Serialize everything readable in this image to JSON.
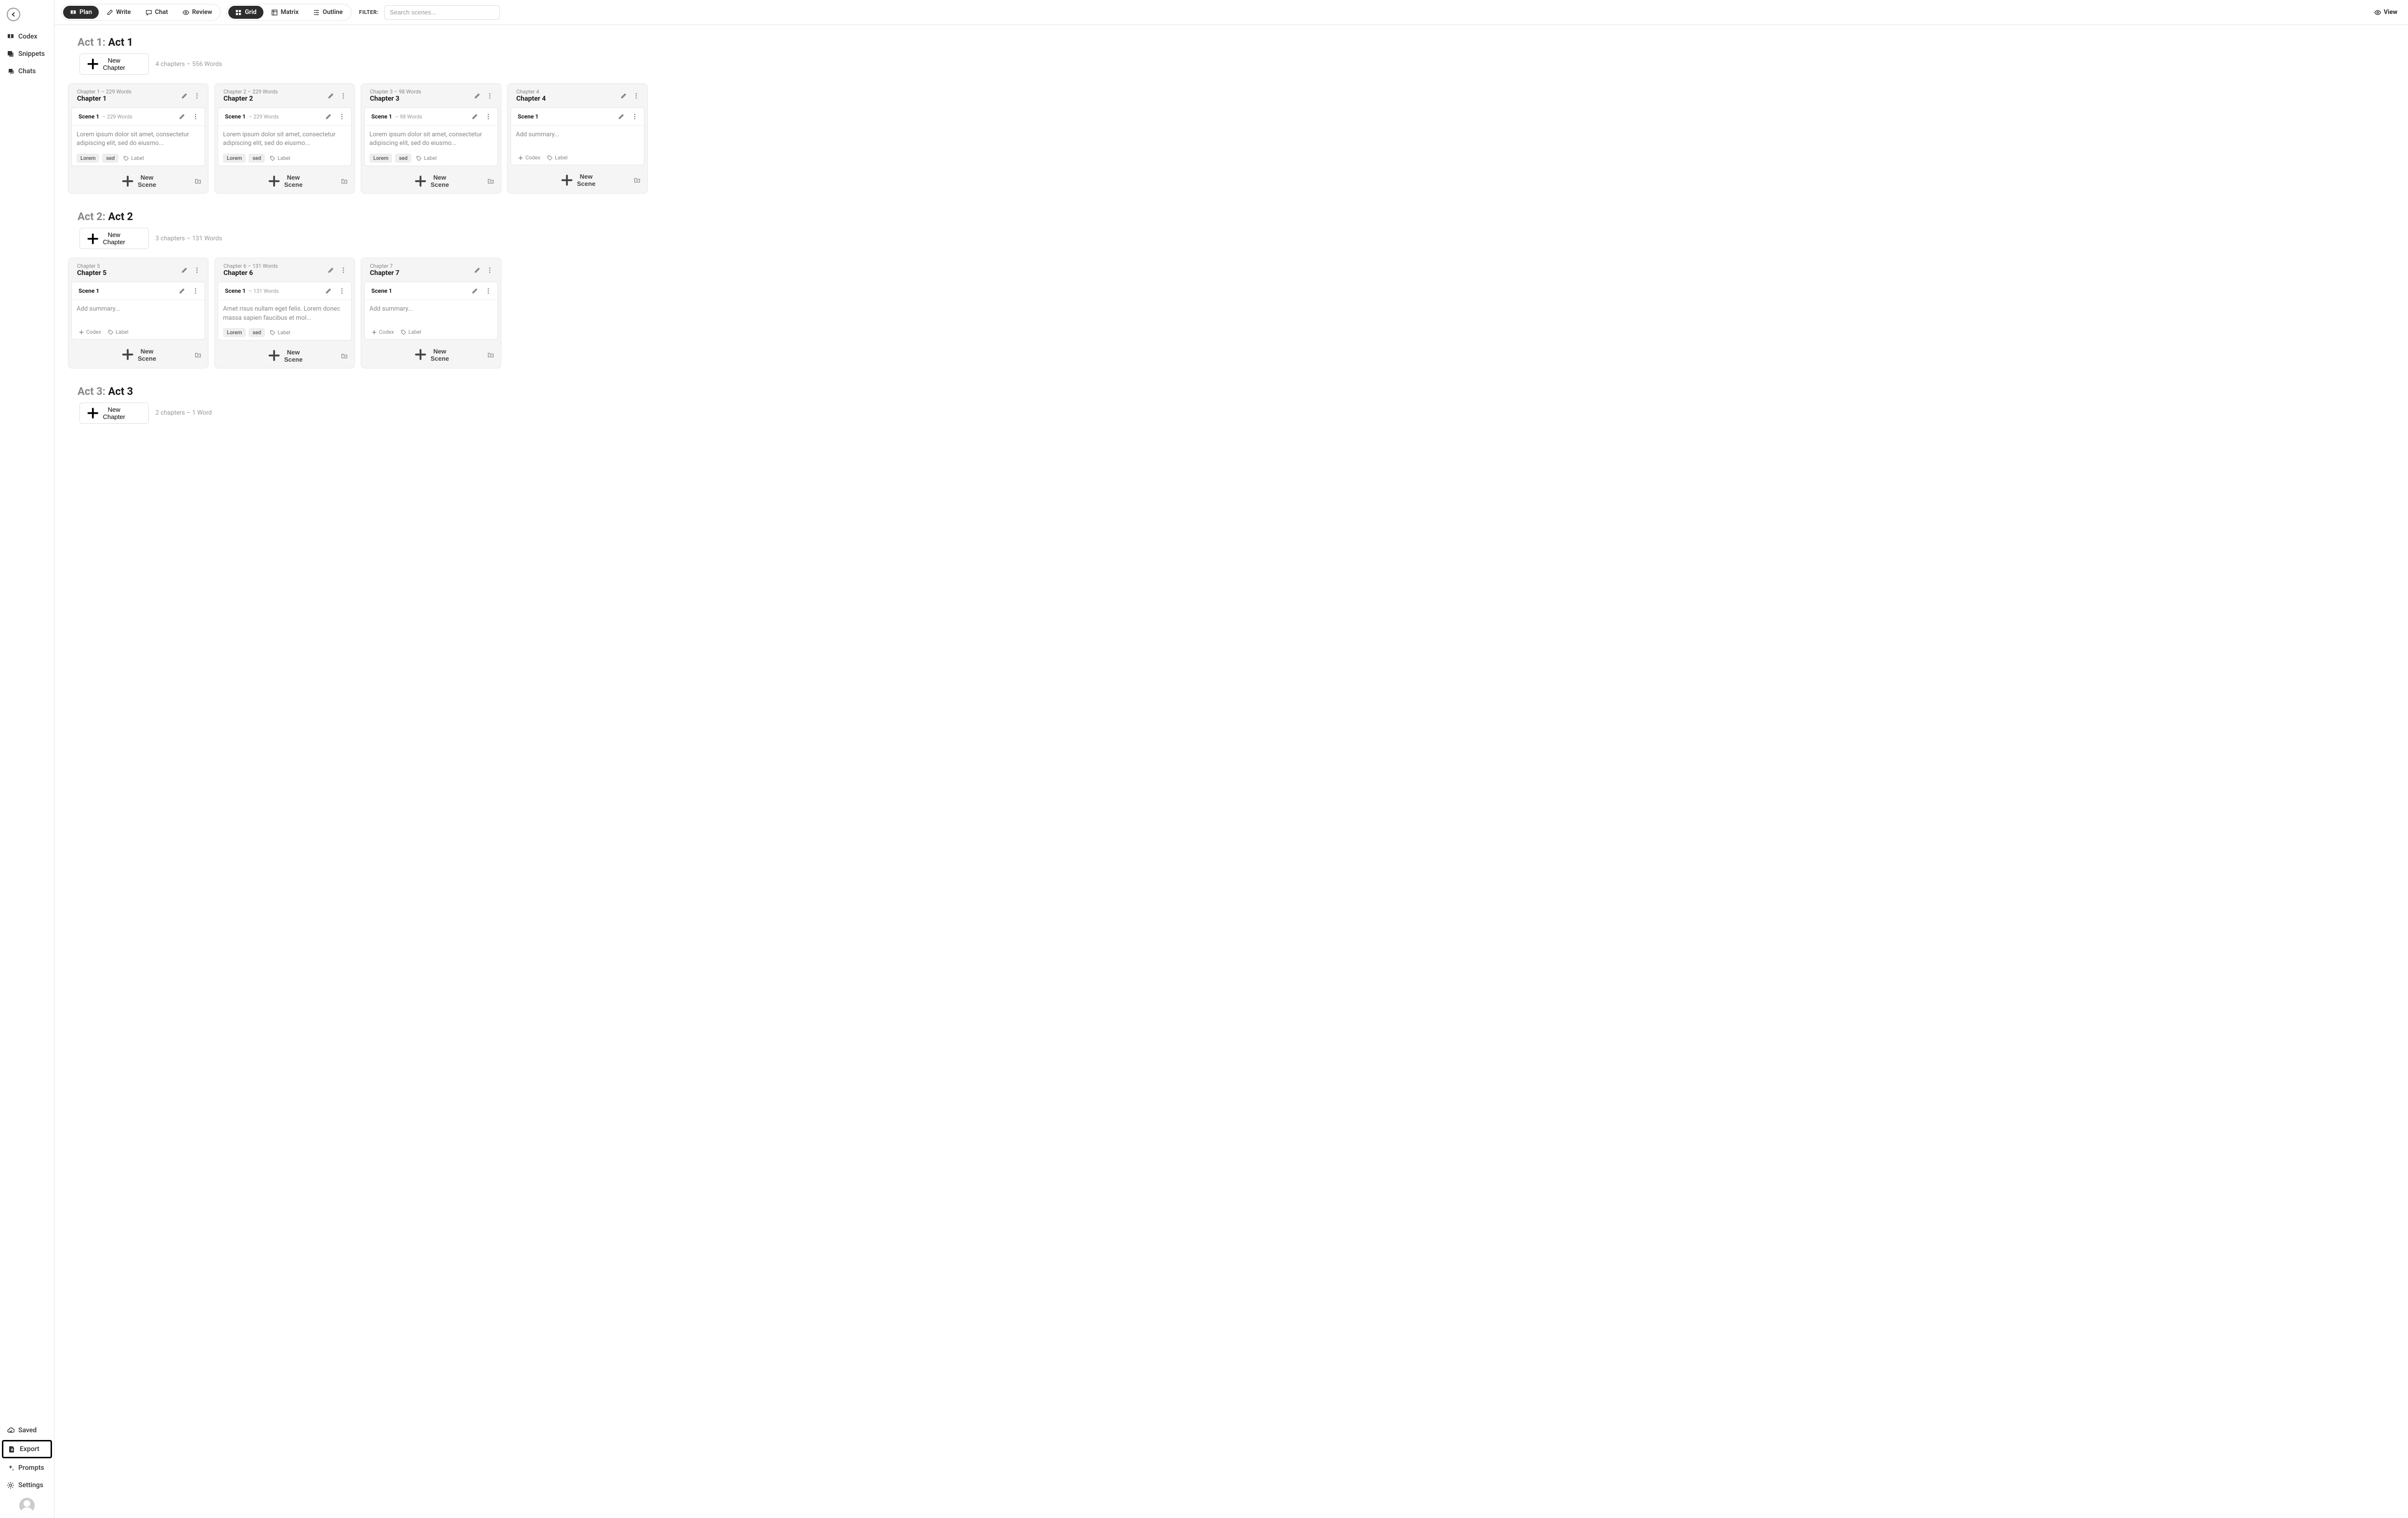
{
  "sidebar": {
    "items": [
      {
        "label": "Codex",
        "icon": "book"
      },
      {
        "label": "Snippets",
        "icon": "snippets"
      },
      {
        "label": "Chats",
        "icon": "chats"
      }
    ],
    "bottom": [
      {
        "label": "Saved",
        "icon": "cloud"
      },
      {
        "label": "Export",
        "icon": "export",
        "highlighted": true
      },
      {
        "label": "Prompts",
        "icon": "sparkles"
      },
      {
        "label": "Settings",
        "icon": "gear"
      }
    ]
  },
  "topbar": {
    "modes": [
      {
        "label": "Plan",
        "active": true
      },
      {
        "label": "Write",
        "active": false
      },
      {
        "label": "Chat",
        "active": false
      },
      {
        "label": "Review",
        "active": false
      }
    ],
    "views": [
      {
        "label": "Grid",
        "active": true
      },
      {
        "label": "Matrix",
        "active": false
      },
      {
        "label": "Outline",
        "active": false
      }
    ],
    "filter_label": "FILTER:",
    "search_placeholder": "Search scenes...",
    "view_label": "View"
  },
  "strings": {
    "new_chapter": "New Chapter",
    "new_scene": "New Scene",
    "codex_btn": "Codex",
    "label_btn": "Label",
    "add_summary": "Add summary..."
  },
  "acts": [
    {
      "prefix": "Act 1:",
      "name": "Act 1",
      "meta": "4 chapters  –  556 Words",
      "chapters": [
        {
          "label": "Chapter 1  –  229 Words",
          "title": "Chapter 1",
          "scenes": [
            {
              "title": "Scene 1",
              "meta": "–  229 Words",
              "summary": "Lorem ipsum dolor sit amet, consectetur adipiscing elit, sed do eiusmo...",
              "tags": [
                "Lorem",
                "sed"
              ],
              "has_codex": false
            }
          ]
        },
        {
          "label": "Chapter 2  –  229 Words",
          "title": "Chapter 2",
          "scenes": [
            {
              "title": "Scene 1",
              "meta": "–  229 Words",
              "summary": "Lorem ipsum dolor sit amet, consectetur adipiscing elit, sed do eiusmo...",
              "tags": [
                "Lorem",
                "sed"
              ],
              "has_codex": false
            }
          ]
        },
        {
          "label": "Chapter 3  –  98 Words",
          "title": "Chapter 3",
          "scenes": [
            {
              "title": "Scene 1",
              "meta": "–  98 Words",
              "summary": "Lorem ipsum dolor sit amet, consectetur adipiscing elit, sed do eiusmo...",
              "tags": [
                "Lorem",
                "sed"
              ],
              "has_codex": false
            }
          ]
        },
        {
          "label": "Chapter 4",
          "title": "Chapter 4",
          "scenes": [
            {
              "title": "Scene 1",
              "meta": "",
              "summary": "",
              "tags": [],
              "has_codex": true
            }
          ]
        }
      ]
    },
    {
      "prefix": "Act 2:",
      "name": "Act 2",
      "meta": "3 chapters  –  131 Words",
      "chapters": [
        {
          "label": "Chapter 5",
          "title": "Chapter 5",
          "scenes": [
            {
              "title": "Scene 1",
              "meta": "",
              "summary": "",
              "tags": [],
              "has_codex": true
            }
          ]
        },
        {
          "label": "Chapter 6  –  131 Words",
          "title": "Chapter 6",
          "scenes": [
            {
              "title": "Scene 1",
              "meta": "–  131 Words",
              "summary": "Amet risus nullam eget felis. Lorem donec massa sapien faucibus et mol...",
              "tags": [
                "Lorem",
                "sed"
              ],
              "has_codex": false
            }
          ]
        },
        {
          "label": "Chapter 7",
          "title": "Chapter 7",
          "scenes": [
            {
              "title": "Scene 1",
              "meta": "",
              "summary": "",
              "tags": [],
              "has_codex": true
            }
          ]
        }
      ]
    },
    {
      "prefix": "Act 3:",
      "name": "Act 3",
      "meta": "2 chapters  –  1 Word",
      "chapters": []
    }
  ]
}
